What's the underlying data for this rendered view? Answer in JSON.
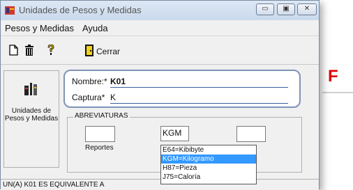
{
  "window": {
    "title": "Unidades de Pesos y Medidas",
    "min_glyph": "▭",
    "max_glyph": "▣",
    "close_glyph": "✕"
  },
  "menu": {
    "items": [
      {
        "label": "Pesos y Medidas"
      },
      {
        "label": "Ayuda"
      }
    ]
  },
  "toolbar": {
    "close_label": "Cerrar"
  },
  "sidebar": {
    "label": "Unidades de Pesos y Medidas"
  },
  "form": {
    "nombre_label": "Nombre:*",
    "nombre_value": "K01",
    "captura_label": "Captura*",
    "captura_value": "K"
  },
  "abreviaturas": {
    "caption": "ABREVIATURAS",
    "reportes_label": "Reportes",
    "input_value": "KGM",
    "options": [
      {
        "label": "E64=Kibibyte"
      },
      {
        "label": "KGM=Kilogramo"
      },
      {
        "label": "H87=Pieza"
      },
      {
        "label": "J75=Caloría"
      }
    ],
    "selected_index": 1
  },
  "status": {
    "text": "UN(A) K01 ES EQUIVALENTE A"
  },
  "background": {
    "letter": "F"
  },
  "colors": {
    "selection": "#3399ff",
    "accent_red": "#e00000",
    "name_border": "#7f93b8"
  }
}
